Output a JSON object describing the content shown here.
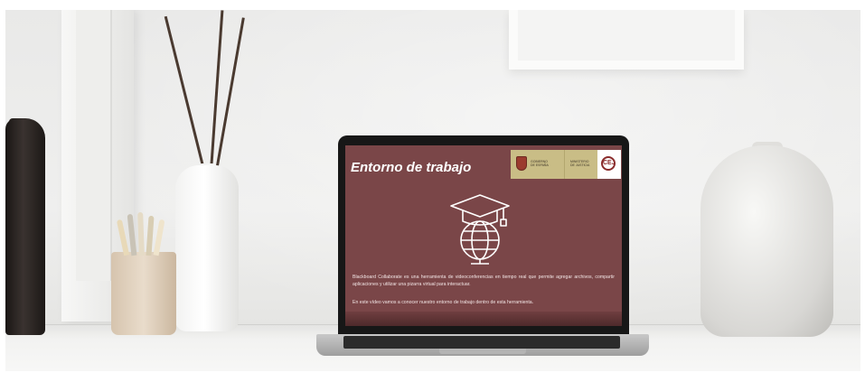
{
  "slide": {
    "title": "Entorno de trabajo",
    "paragraph_1": "Blackboard Collaborate es una herramienta de videoconferencias en tiempo real que permite agregar archivos, compartir aplicaciones y utilizar una pizarra virtual para interactuar.",
    "paragraph_2": "En este vídeo vamos a conocer nuestro entorno de trabajo dentro de esta herramienta.",
    "icon": "graduation-cap-globe-icon",
    "background_color": "#7a4648"
  },
  "logos": {
    "government_text": "GOBIERNO\nDE ESPAÑA",
    "ministry_text": "MINISTERIO\nDE JUSTICIA",
    "cej_mark": "CEJ"
  }
}
